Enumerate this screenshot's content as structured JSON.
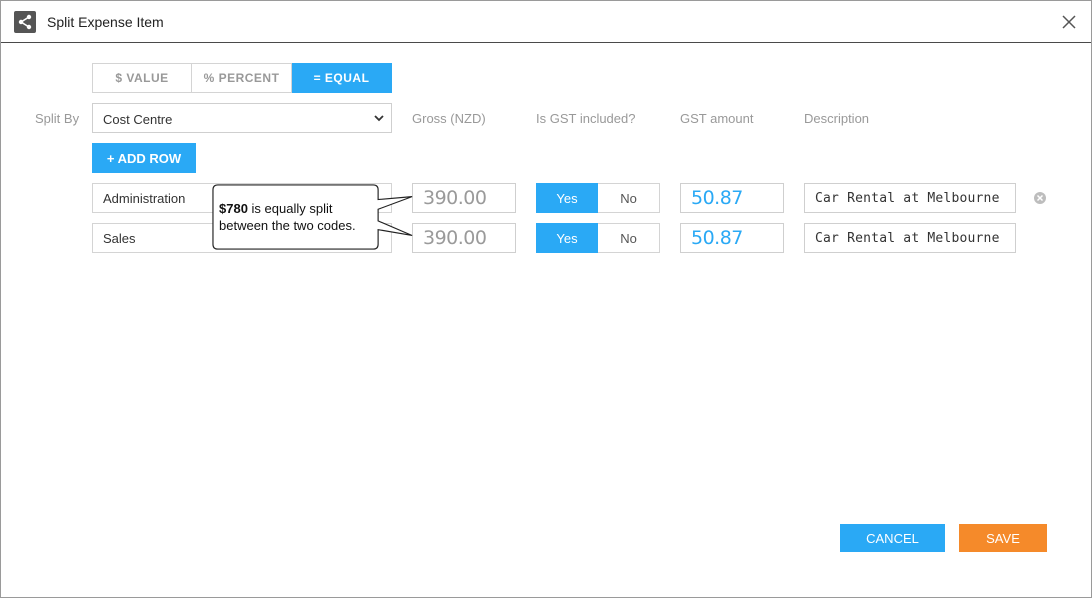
{
  "dialog": {
    "title": "Split Expense Item",
    "icon": "share-icon"
  },
  "modes": [
    {
      "label": "$ VALUE",
      "active": false
    },
    {
      "label": "% PERCENT",
      "active": false
    },
    {
      "label": "= EQUAL",
      "active": true
    }
  ],
  "split_by": {
    "label": "Split By",
    "selected": "Cost Centre"
  },
  "columns": {
    "gross": "Gross (NZD)",
    "gst_included": "Is GST included?",
    "gst_amount": "GST amount",
    "description": "Description"
  },
  "add_row_label": "+ ADD ROW",
  "rows": [
    {
      "code": "Administration",
      "gross": "390.00",
      "gst_yes": "Yes",
      "gst_no": "No",
      "gst_selected": "Yes",
      "gst_amount": "50.87",
      "description": "Car Rental at Melbourne"
    },
    {
      "code": "Sales",
      "gross": "390.00",
      "gst_yes": "Yes",
      "gst_no": "No",
      "gst_selected": "Yes",
      "gst_amount": "50.87",
      "description": "Car Rental at Melbourne"
    }
  ],
  "callout": {
    "bold": "$780",
    "text_line1": " is equally split",
    "text_line2": "between the two codes."
  },
  "footer": {
    "cancel_label": "CANCEL",
    "save_label": "SAVE"
  },
  "colors": {
    "accent": "#2aa9f5",
    "save": "#f58a2a"
  }
}
